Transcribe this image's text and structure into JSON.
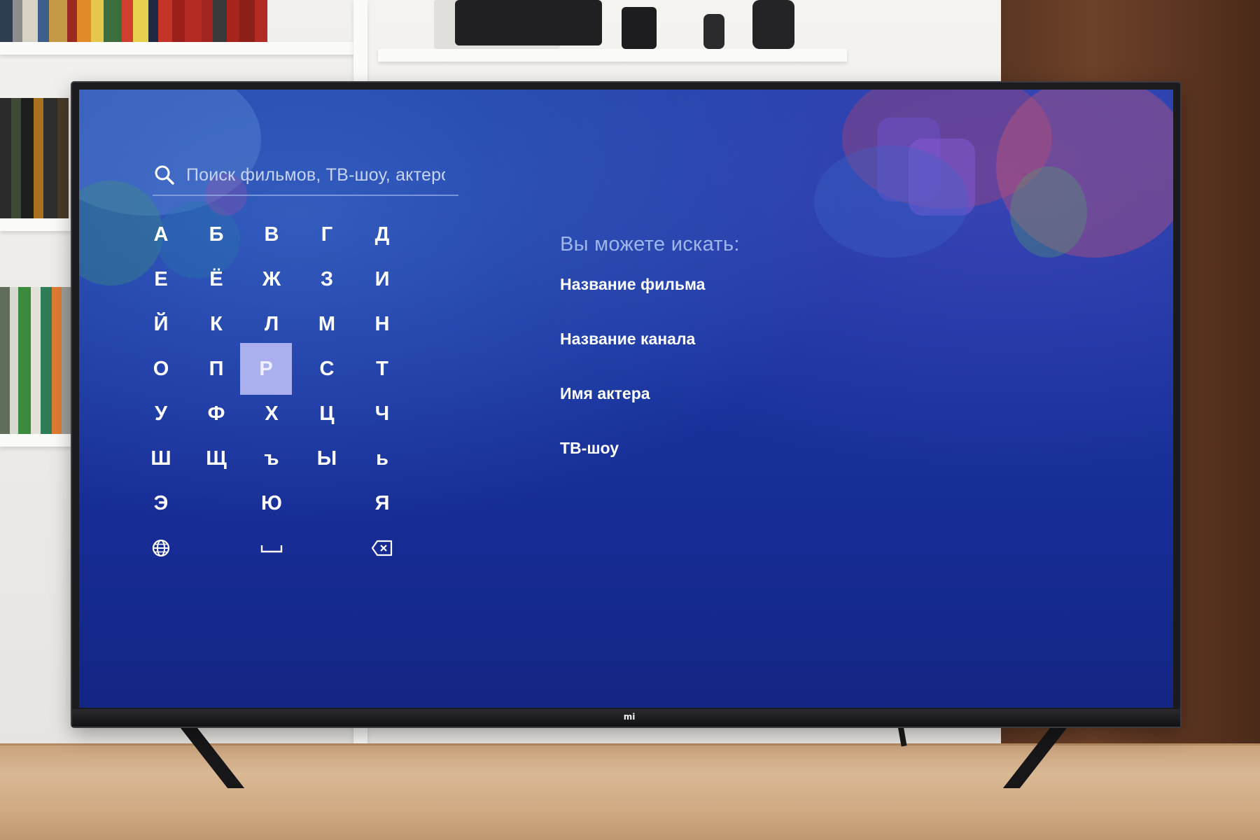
{
  "tv": {
    "brand_logo": "mi"
  },
  "search": {
    "placeholder": "Поиск фильмов, ТВ-шоу, актеров",
    "icon": "search-icon"
  },
  "keyboard": {
    "rows": [
      [
        "А",
        "Б",
        "В",
        "Г",
        "Д"
      ],
      [
        "Е",
        "Ё",
        "Ж",
        "З",
        "И"
      ],
      [
        "Й",
        "К",
        "Л",
        "М",
        "Н"
      ],
      [
        "О",
        "П",
        "Р",
        "С",
        "Т"
      ],
      [
        "У",
        "Ф",
        "Х",
        "Ц",
        "Ч"
      ],
      [
        "Ш",
        "Щ",
        "ъ",
        "Ы",
        "ь"
      ],
      [
        "Э",
        "",
        "Ю",
        "",
        "Я"
      ]
    ],
    "selected_key": "Р",
    "selected_color": "#aab0ee",
    "function_keys": {
      "language": "globe-icon",
      "space": "space-icon",
      "backspace": "backspace-icon"
    }
  },
  "hints": {
    "title": "Вы можете искать:",
    "items": [
      "Название фильма",
      "Название канала",
      "Имя актера",
      "ТВ-шоу"
    ]
  },
  "colors": {
    "screen_top": "#1f3fa8",
    "screen_bottom": "#132684",
    "hint_title": "#9fb6ec",
    "text": "#ffffff"
  }
}
